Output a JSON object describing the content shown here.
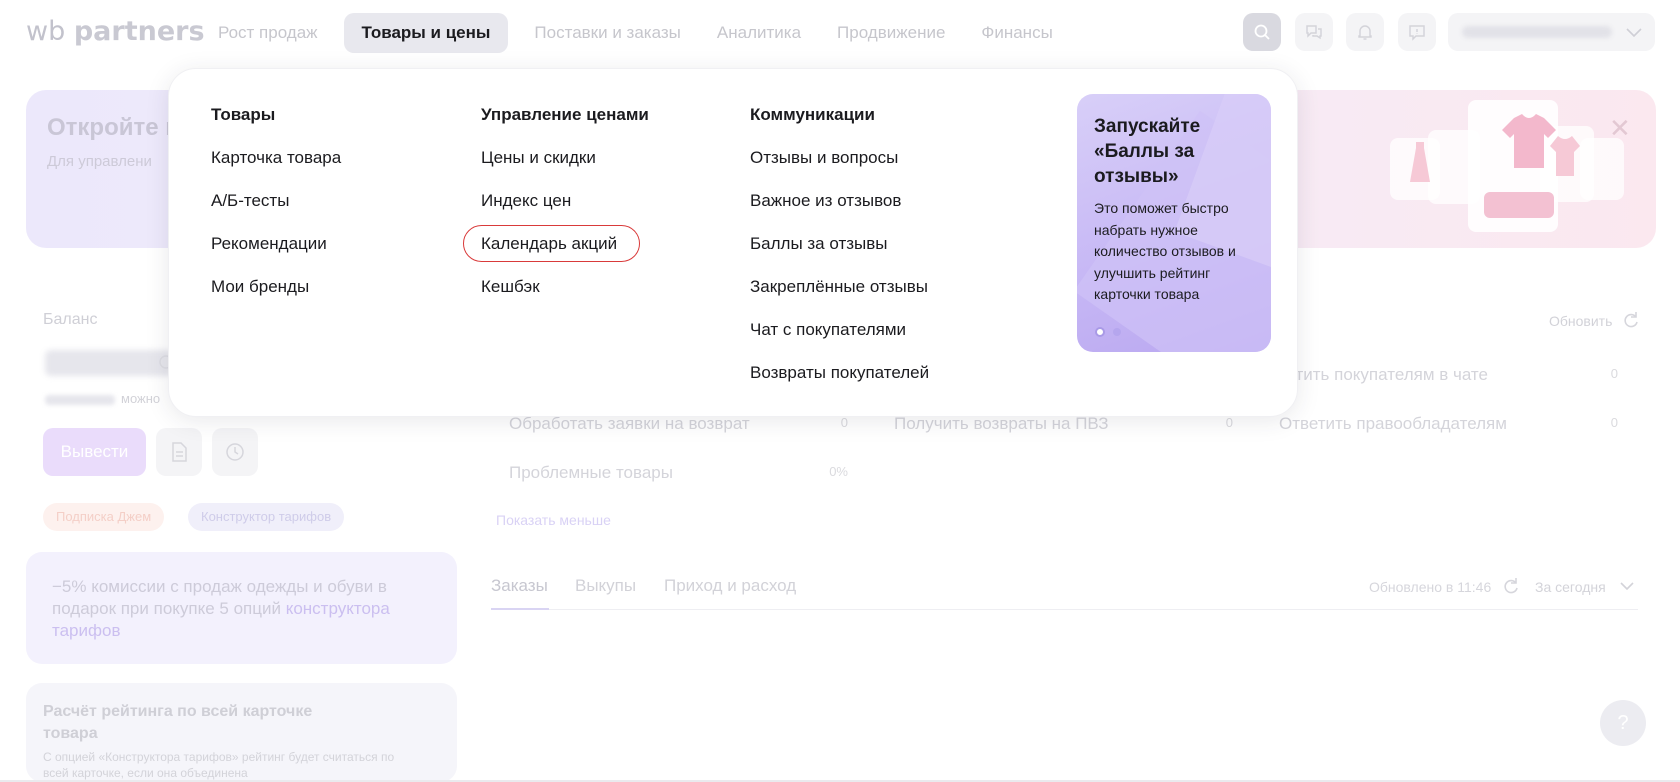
{
  "header": {
    "logo_light": "wb",
    "logo_bold": "partners",
    "nav": [
      {
        "label": "Рост продаж",
        "active": false
      },
      {
        "label": "Товары и цены",
        "active": true
      },
      {
        "label": "Поставки и заказы",
        "active": false
      },
      {
        "label": "Аналитика",
        "active": false
      },
      {
        "label": "Продвижение",
        "active": false
      },
      {
        "label": "Финансы",
        "active": false
      }
    ],
    "icons": [
      "search-icon",
      "chat-icon",
      "bell-icon",
      "support-icon",
      "chevron-down-icon"
    ]
  },
  "menu": {
    "columns": [
      {
        "heading": "Товары",
        "links": [
          "Карточка товара",
          "А/Б-тесты",
          "Рекомендации",
          "Мои бренды"
        ]
      },
      {
        "heading": "Управление ценами",
        "links": [
          "Цены и скидки",
          "Индекс цен",
          "Календарь акций",
          "Кешбэк"
        ]
      },
      {
        "heading": "Коммуникации",
        "links": [
          "Отзывы и вопросы",
          "Важное из отзывов",
          "Баллы за отзывы",
          "Закреплённые отзывы",
          "Чат с покупателями",
          "Возвраты покупателей"
        ]
      }
    ],
    "highlighted_link": "Календарь акций",
    "banner": {
      "title": "Запускайте «Баллы за отзывы»",
      "text": "Это поможет быстро набрать нужное количество отзывов и улучшить рейтинг карточки товара",
      "slides": 2,
      "active_slide": 1
    }
  },
  "background": {
    "promo_title": "Откройте к",
    "promo_sub": "Для управлени",
    "balance_label": "Баланс",
    "balance_note": "можно",
    "withdraw_label": "Вывести",
    "tags": [
      "Подписка Джем",
      "Конструктор тарифов"
    ],
    "offer_text": "−5% комиссии с продаж одежды и обуви в подарок при покупке 5 опций ",
    "offer_link": "конструктора тарифов",
    "rating_title": "Расчёт рейтинга по всей карточке товара",
    "rating_body": "С опцией «Конструктора тарифов» рейтинг будет считаться по всей карточке, если она объединена",
    "refresh_label": "Обновить",
    "tasks": [
      {
        "label": "зетить покупателям в чате",
        "count": "0"
      },
      {
        "label": "Обработать заявки на возврат",
        "count": "0"
      },
      {
        "label": "Получить возвраты на ПВЗ",
        "count": "0"
      },
      {
        "label": "Ответить правообладателям",
        "count": "0"
      },
      {
        "label": "Проблемные товары",
        "count": "0%"
      }
    ],
    "show_less": "Показать меньше",
    "tabs": [
      "Заказы",
      "Выкупы",
      "Приход и расход"
    ],
    "updated": "Обновлено в 11:46",
    "period": "За сегодня",
    "help": "?"
  }
}
